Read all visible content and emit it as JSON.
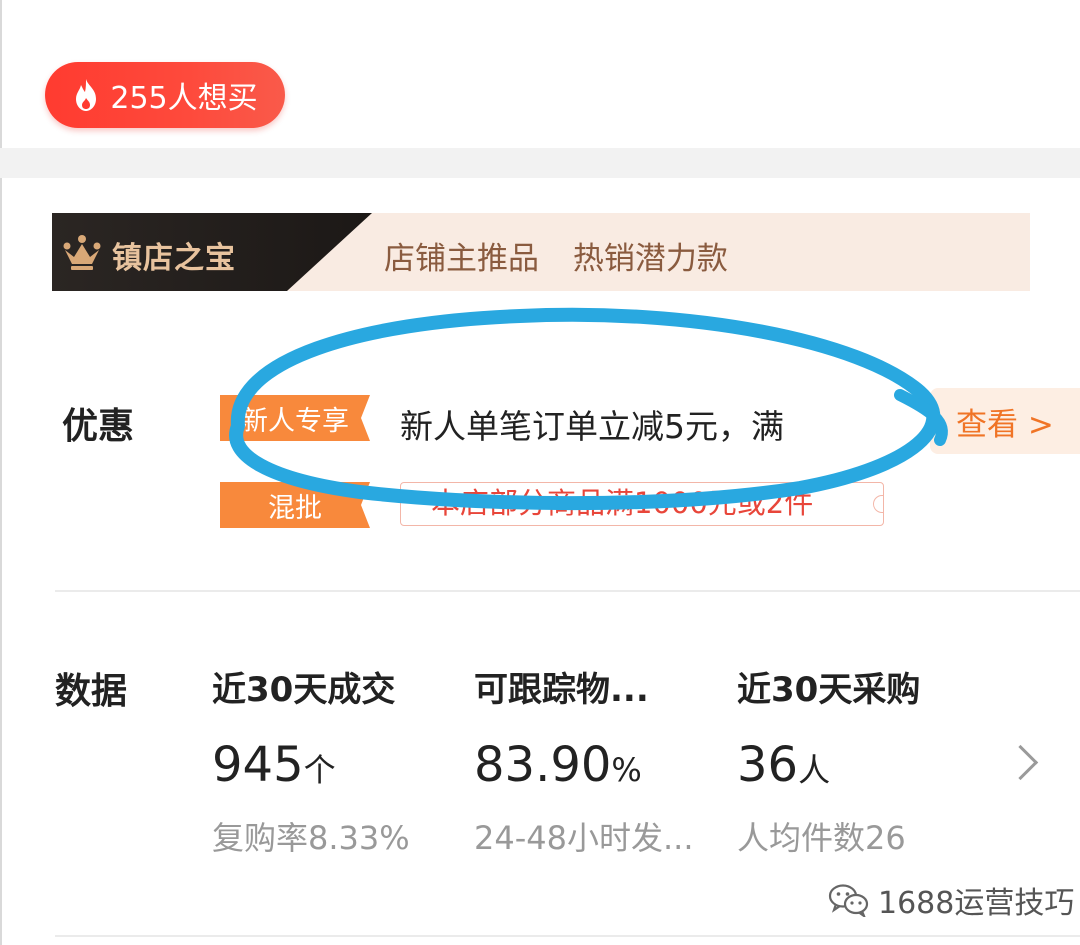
{
  "want_badge": {
    "label": "255人想买"
  },
  "treasure_banner": {
    "title": "镇店之宝",
    "tags": [
      "店铺主推品",
      "热销潜力款"
    ]
  },
  "discount": {
    "label": "优惠",
    "rows": [
      {
        "tag": "新人专享",
        "text": "新人单笔订单立减5元，满"
      },
      {
        "tag": "混批",
        "text": "本店部分商品满1000元或2件"
      }
    ],
    "view_button": "查看 >"
  },
  "data_section": {
    "label": "数据",
    "metrics": [
      {
        "title": "近30天成交",
        "value": "945",
        "unit": "个",
        "sub": "复购率8.33%"
      },
      {
        "title": "可跟踪物...",
        "value": "83.90",
        "unit": "%",
        "sub": "24-48小时发..."
      },
      {
        "title": "近30天采购",
        "value": "36",
        "unit": "人",
        "sub": "人均件数26"
      }
    ]
  },
  "watermark": {
    "text": "1688运营技巧"
  },
  "colors": {
    "badge_red": "#ff3b30",
    "tag_orange": "#f8893c",
    "view_orange": "#f07426",
    "highlight_circle": "#29a8e0"
  }
}
